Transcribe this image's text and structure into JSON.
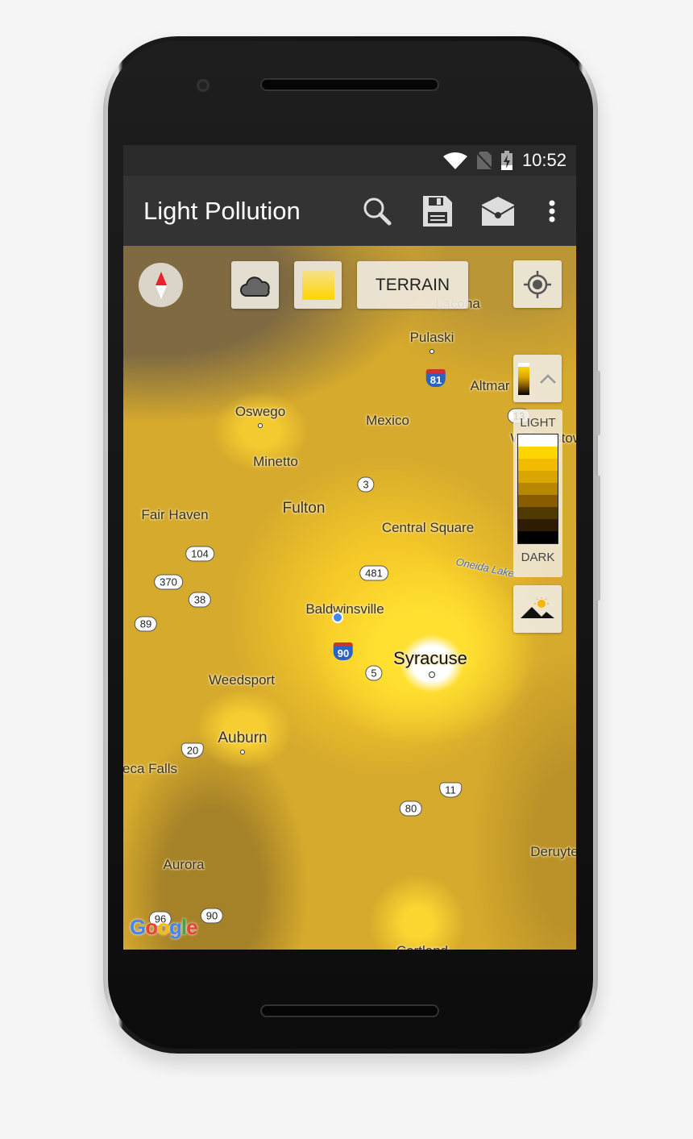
{
  "status_bar": {
    "time": "10:52",
    "icons": [
      "wifi-icon",
      "no-sim-icon",
      "battery-charging-icon"
    ]
  },
  "app_bar": {
    "title": "Light Pollution",
    "actions": [
      "search-icon",
      "save-icon",
      "open-mail-icon",
      "more-vert-icon"
    ]
  },
  "map_controls": {
    "terrain_label": "TERRAIN",
    "legend_light": "LIGHT",
    "legend_dark": "DARK",
    "legend_colors": [
      "#ffffff",
      "#fdd600",
      "#f3bb00",
      "#d9a600",
      "#b98600",
      "#8a5c00",
      "#503a00",
      "#2e1c00",
      "#000000"
    ]
  },
  "map": {
    "places": [
      "Lacona",
      "Pulaski",
      "Altmar",
      "Oswego",
      "Mexico",
      "Williamstown",
      "Minetto",
      "Fulton",
      "Fair Haven",
      "Central Square",
      "Oneida Lake",
      "Baldwinsville",
      "Syracuse",
      "Weedsport",
      "Auburn",
      "eca Falls",
      "Aurora",
      "Deruyte",
      "Cortland"
    ],
    "routes": [
      "81",
      "13",
      "3",
      "104",
      "370",
      "481",
      "38",
      "89",
      "90",
      "5",
      "20",
      "11",
      "80",
      "96",
      "90"
    ],
    "attribution": "Google"
  }
}
